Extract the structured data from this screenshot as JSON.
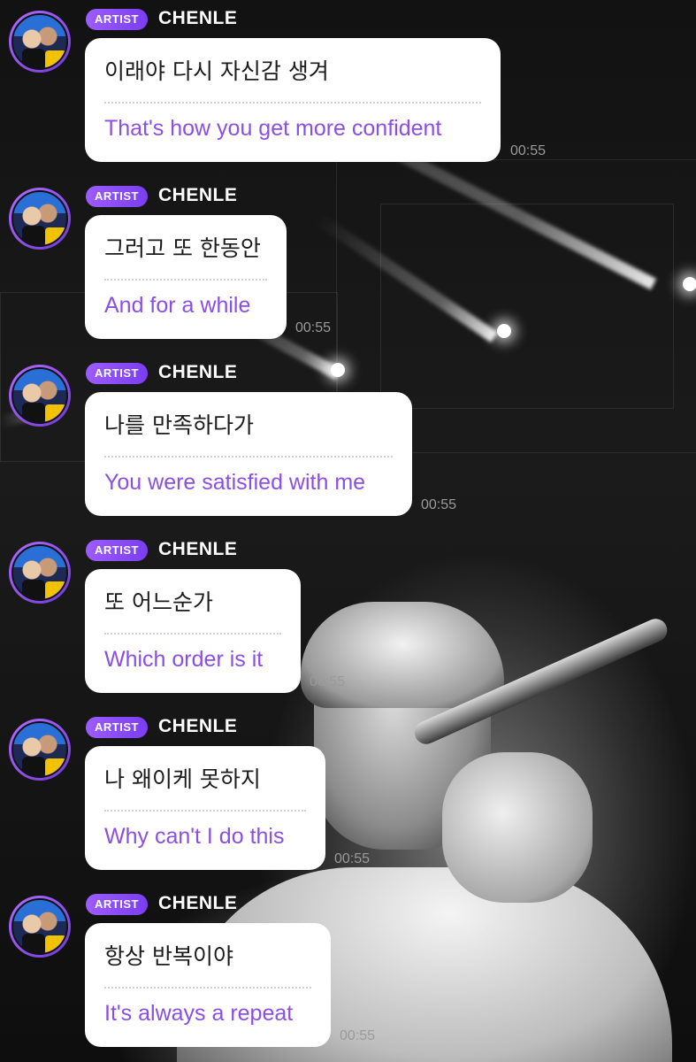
{
  "colors": {
    "badge": "#8b4cf5",
    "translation_text": "#8a4fe6",
    "bubble": "#ffffff",
    "timestamp": "#9a9a9a"
  },
  "messages": [
    {
      "badge": "ARTIST",
      "sender": "CHENLE",
      "korean": "이래야 다시 자신감 생겨",
      "english": "That's how you get more confident",
      "time": "00:55"
    },
    {
      "badge": "ARTIST",
      "sender": "CHENLE",
      "korean": "그러고 또 한동안",
      "english": "And for a while",
      "time": "00:55"
    },
    {
      "badge": "ARTIST",
      "sender": "CHENLE",
      "korean": "나를 만족하다가",
      "english": "You were satisfied with me",
      "time": "00:55"
    },
    {
      "badge": "ARTIST",
      "sender": "CHENLE",
      "korean": "또 어느순가",
      "english": "Which order is it",
      "time": "00:55"
    },
    {
      "badge": "ARTIST",
      "sender": "CHENLE",
      "korean": "나 왜이케 못하지",
      "english": "Why can't I do this",
      "time": "00:55"
    },
    {
      "badge": "ARTIST",
      "sender": "CHENLE",
      "korean": "항상 반복이야",
      "english": "It's always a repeat",
      "time": "00:55"
    }
  ]
}
